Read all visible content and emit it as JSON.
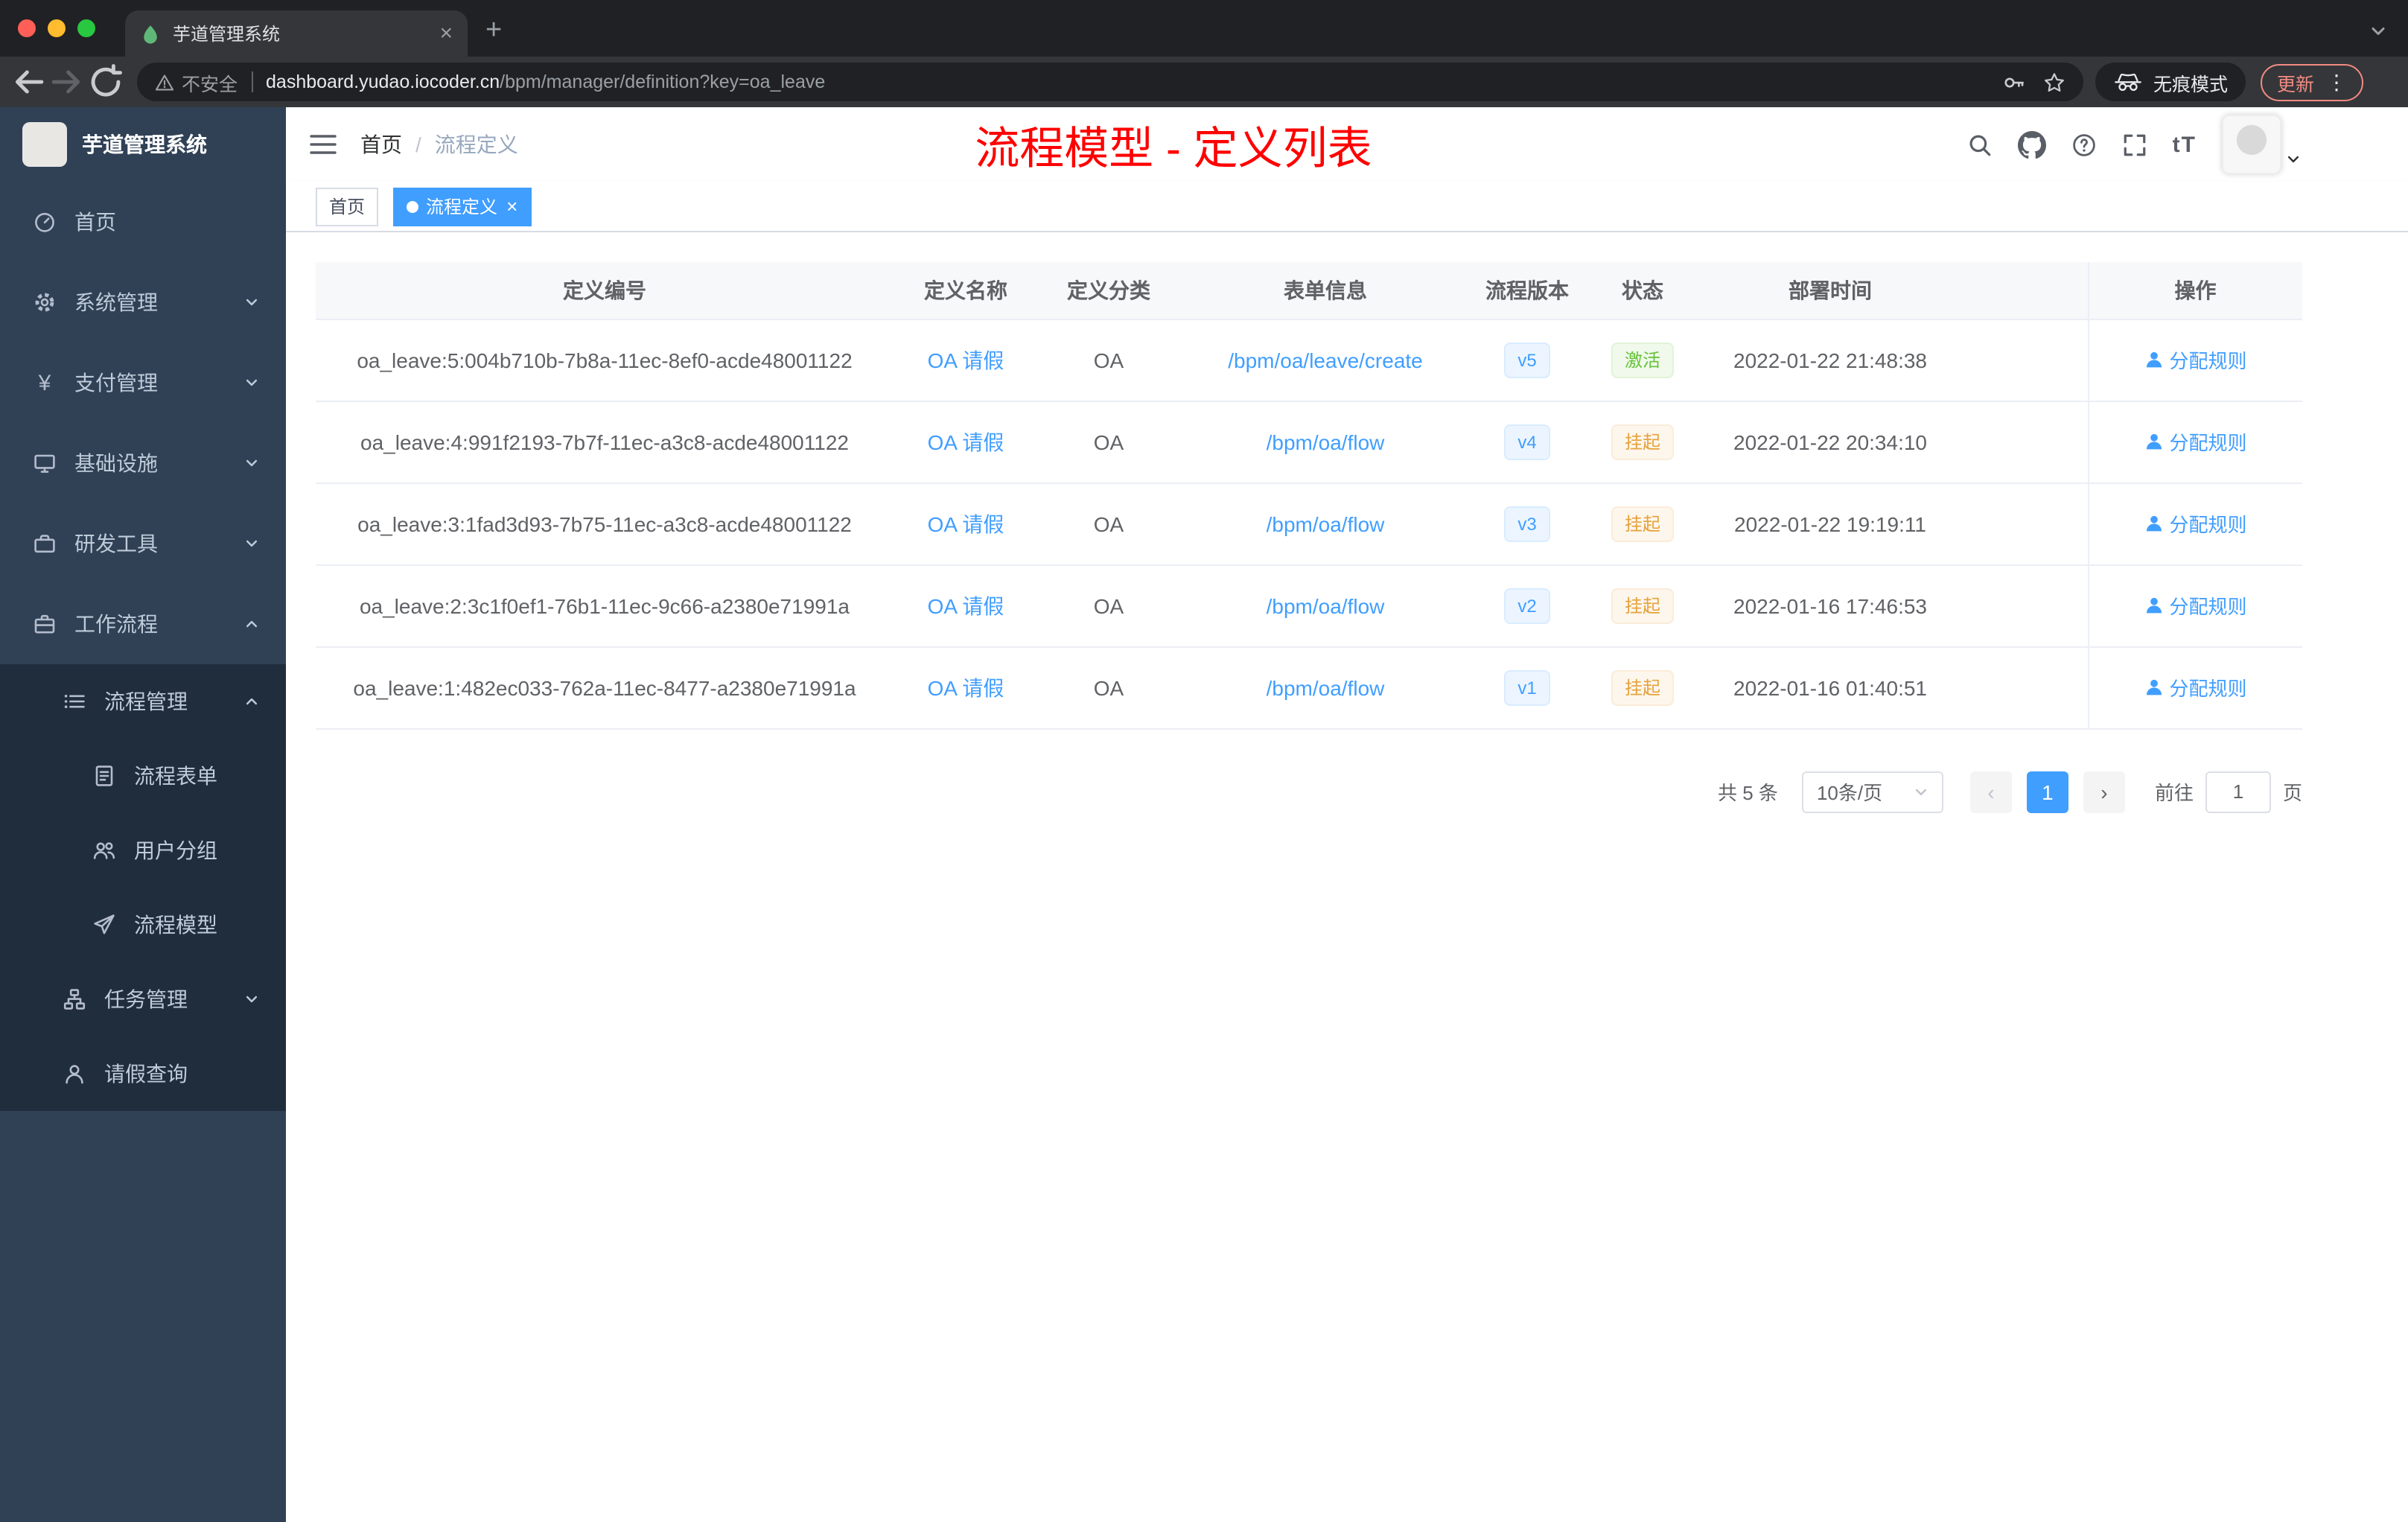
{
  "colors": {
    "primary": "#409eff",
    "banner_red": "#ff0000",
    "success_green": "#67c23a",
    "warning_orange": "#e6a23c",
    "sidebar_bg": "#304156",
    "sidebar_sub_bg": "#1f2d3d"
  },
  "browser": {
    "tab_title": "芋道管理系统",
    "security_label": "不安全",
    "url_domain": "dashboard.yudao.iocoder.cn",
    "url_path": "/bpm/manager/definition?key=oa_leave",
    "incognito_label": "无痕模式",
    "update_label": "更新"
  },
  "sidebar": {
    "logo_title": "芋道管理系统",
    "items": [
      {
        "key": "home",
        "icon": "dashboard-icon",
        "label": "首页",
        "level": 1
      },
      {
        "key": "system",
        "icon": "gear-icon",
        "label": "系统管理",
        "level": 1,
        "chevron": "down"
      },
      {
        "key": "payment",
        "icon": "yen-icon",
        "label": "支付管理",
        "level": 1,
        "chevron": "down"
      },
      {
        "key": "infrastructure",
        "icon": "monitor-icon",
        "label": "基础设施",
        "level": 1,
        "chevron": "down"
      },
      {
        "key": "dev-tools",
        "icon": "toolbox-icon",
        "label": "研发工具",
        "level": 1,
        "chevron": "down"
      },
      {
        "key": "workflow",
        "icon": "briefcase-icon",
        "label": "工作流程",
        "level": 1,
        "chevron": "up"
      },
      {
        "key": "process-manage",
        "icon": "list-icon",
        "label": "流程管理",
        "level": 2,
        "chevron": "up",
        "sub": true
      },
      {
        "key": "process-form",
        "icon": "form-icon",
        "label": "流程表单",
        "level": 3,
        "sub": true
      },
      {
        "key": "user-group",
        "icon": "users-icon",
        "label": "用户分组",
        "level": 3,
        "sub": true
      },
      {
        "key": "process-model",
        "icon": "paper-plane-icon",
        "label": "流程模型",
        "level": 3,
        "sub": true
      },
      {
        "key": "task-manage",
        "icon": "tree-icon",
        "label": "任务管理",
        "level": 2,
        "chevron": "down",
        "sub": true
      },
      {
        "key": "leave-query",
        "icon": "user-icon",
        "label": "请假查询",
        "level": 2,
        "sub": true
      }
    ]
  },
  "navbar": {
    "breadcrumb": {
      "home": "首页",
      "separator": "/",
      "current": "流程定义"
    },
    "banner": "流程模型 - 定义列表",
    "text_size_label": "tT"
  },
  "tags": [
    {
      "label": "首页",
      "active": false,
      "closable": false
    },
    {
      "label": "流程定义",
      "active": true,
      "closable": true
    }
  ],
  "table": {
    "columns": [
      "定义编号",
      "定义名称",
      "定义分类",
      "表单信息",
      "流程版本",
      "状态",
      "部署时间",
      "操作"
    ],
    "rows": [
      {
        "id": "oa_leave:5:004b710b-7b8a-11ec-8ef0-acde48001122",
        "name": "OA 请假",
        "category": "OA",
        "form": "/bpm/oa/leave/create",
        "version": "v5",
        "status": "激活",
        "status_type": "success",
        "time": "2022-01-22 21:48:38",
        "action": "分配规则"
      },
      {
        "id": "oa_leave:4:991f2193-7b7f-11ec-a3c8-acde48001122",
        "name": "OA 请假",
        "category": "OA",
        "form": "/bpm/oa/flow",
        "version": "v4",
        "status": "挂起",
        "status_type": "warning",
        "time": "2022-01-22 20:34:10",
        "action": "分配规则"
      },
      {
        "id": "oa_leave:3:1fad3d93-7b75-11ec-a3c8-acde48001122",
        "name": "OA 请假",
        "category": "OA",
        "form": "/bpm/oa/flow",
        "version": "v3",
        "status": "挂起",
        "status_type": "warning",
        "time": "2022-01-22 19:19:11",
        "action": "分配规则"
      },
      {
        "id": "oa_leave:2:3c1f0ef1-76b1-11ec-9c66-a2380e71991a",
        "name": "OA 请假",
        "category": "OA",
        "form": "/bpm/oa/flow",
        "version": "v2",
        "status": "挂起",
        "status_type": "warning",
        "time": "2022-01-16 17:46:53",
        "action": "分配规则"
      },
      {
        "id": "oa_leave:1:482ec033-762a-11ec-8477-a2380e71991a",
        "name": "OA 请假",
        "category": "OA",
        "form": "/bpm/oa/flow",
        "version": "v1",
        "status": "挂起",
        "status_type": "warning",
        "time": "2022-01-16 01:40:51",
        "action": "分配规则"
      }
    ]
  },
  "pagination": {
    "total": "共 5 条",
    "page_size": "10条/页",
    "prev": "‹",
    "current": "1",
    "next": "›",
    "goto_prefix": "前往",
    "goto_value": "1",
    "goto_suffix": "页"
  },
  "glyphs": {
    "new_tab": "+",
    "close_tab": "×",
    "more_menu": "⋮",
    "tag_close": "×"
  }
}
